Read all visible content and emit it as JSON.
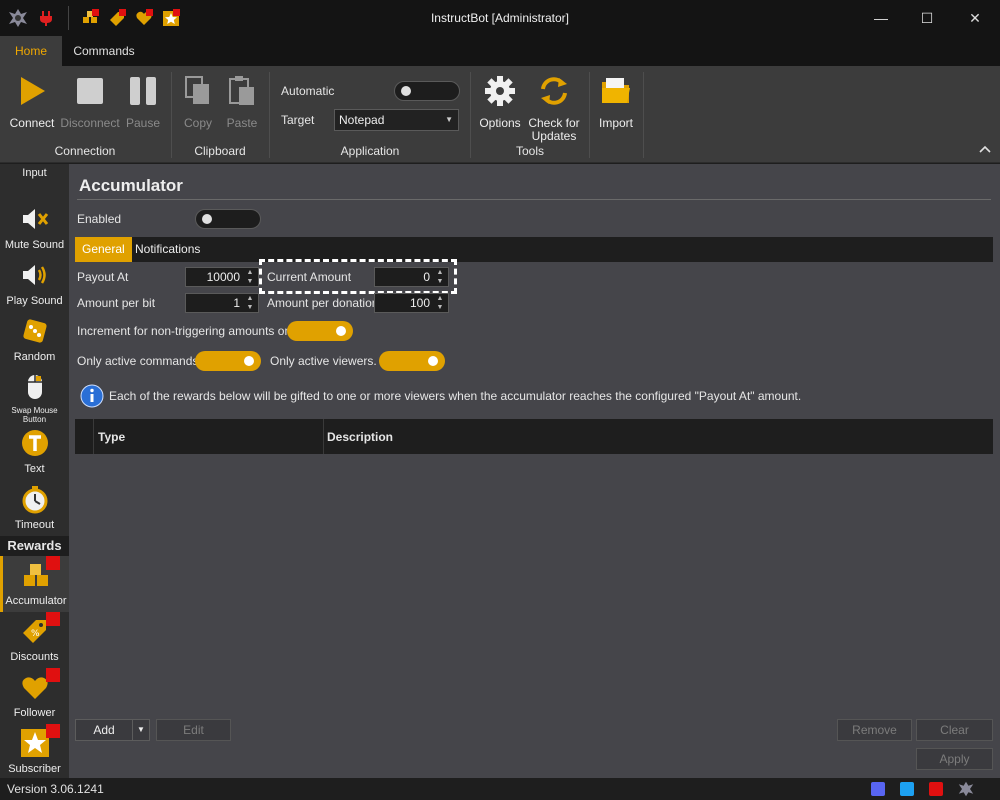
{
  "window": {
    "title": "InstructBot [Administrator]"
  },
  "window_controls": {
    "minimize": "—",
    "maximize": "☐",
    "close": "✕"
  },
  "ribbon_tabs": [
    {
      "label": "Home"
    },
    {
      "label": "Commands"
    }
  ],
  "ribbon": {
    "connection": {
      "label": "Connection",
      "connect": "Connect",
      "disconnect": "Disconnect",
      "pause": "Pause"
    },
    "clipboard": {
      "label": "Clipboard",
      "copy": "Copy",
      "paste": "Paste"
    },
    "application": {
      "label": "Application",
      "automatic_label": "Automatic",
      "target_label": "Target",
      "target_value": "Notepad"
    },
    "tools": {
      "label": "Tools",
      "options": "Options",
      "check_updates_1": "Check for",
      "check_updates_2": "Updates",
      "import": "Import"
    }
  },
  "sidebar": {
    "items": [
      {
        "label": "Input"
      },
      {
        "label": "Mute Sound"
      },
      {
        "label": "Play Sound"
      },
      {
        "label": "Random"
      },
      {
        "label_1": "Swap Mouse",
        "label_2": "Button"
      },
      {
        "label": "Text"
      },
      {
        "label": "Timeout"
      }
    ],
    "section_header": "Rewards",
    "reward_items": [
      {
        "label": "Accumulator"
      },
      {
        "label": "Discounts"
      },
      {
        "label": "Follower"
      },
      {
        "label": "Subscriber"
      }
    ]
  },
  "main": {
    "title": "Accumulator",
    "enabled_label": "Enabled",
    "tabs": [
      {
        "label": "General"
      },
      {
        "label": "Notifications"
      }
    ],
    "payout_at_label": "Payout At",
    "payout_at_value": "10000",
    "current_amount_label": "Current Amount",
    "current_amount_value": "0",
    "amount_per_bit_label": "Amount per bit",
    "amount_per_bit_value": "1",
    "amount_per_donation_label": "Amount per donation",
    "amount_per_donation_value": "100",
    "increment_label": "Increment for non-triggering amounts only",
    "only_active_commands_label": "Only active commands.",
    "only_active_viewers_label": "Only active viewers.",
    "info_text": "Each of the rewards below will be gifted to one or more viewers when the accumulator reaches the configured \"Payout At\" amount.",
    "table": {
      "columns": [
        "Type",
        "Description"
      ],
      "rows": []
    },
    "buttons": {
      "add": "Add",
      "edit": "Edit",
      "remove": "Remove",
      "clear": "Clear",
      "apply": "Apply"
    }
  },
  "status": {
    "version": "Version 3.06.1241"
  },
  "colors": {
    "accent": "#e0a100",
    "badge": "#e01010",
    "panel": "#45454a",
    "dark": "#1e1e1e"
  }
}
